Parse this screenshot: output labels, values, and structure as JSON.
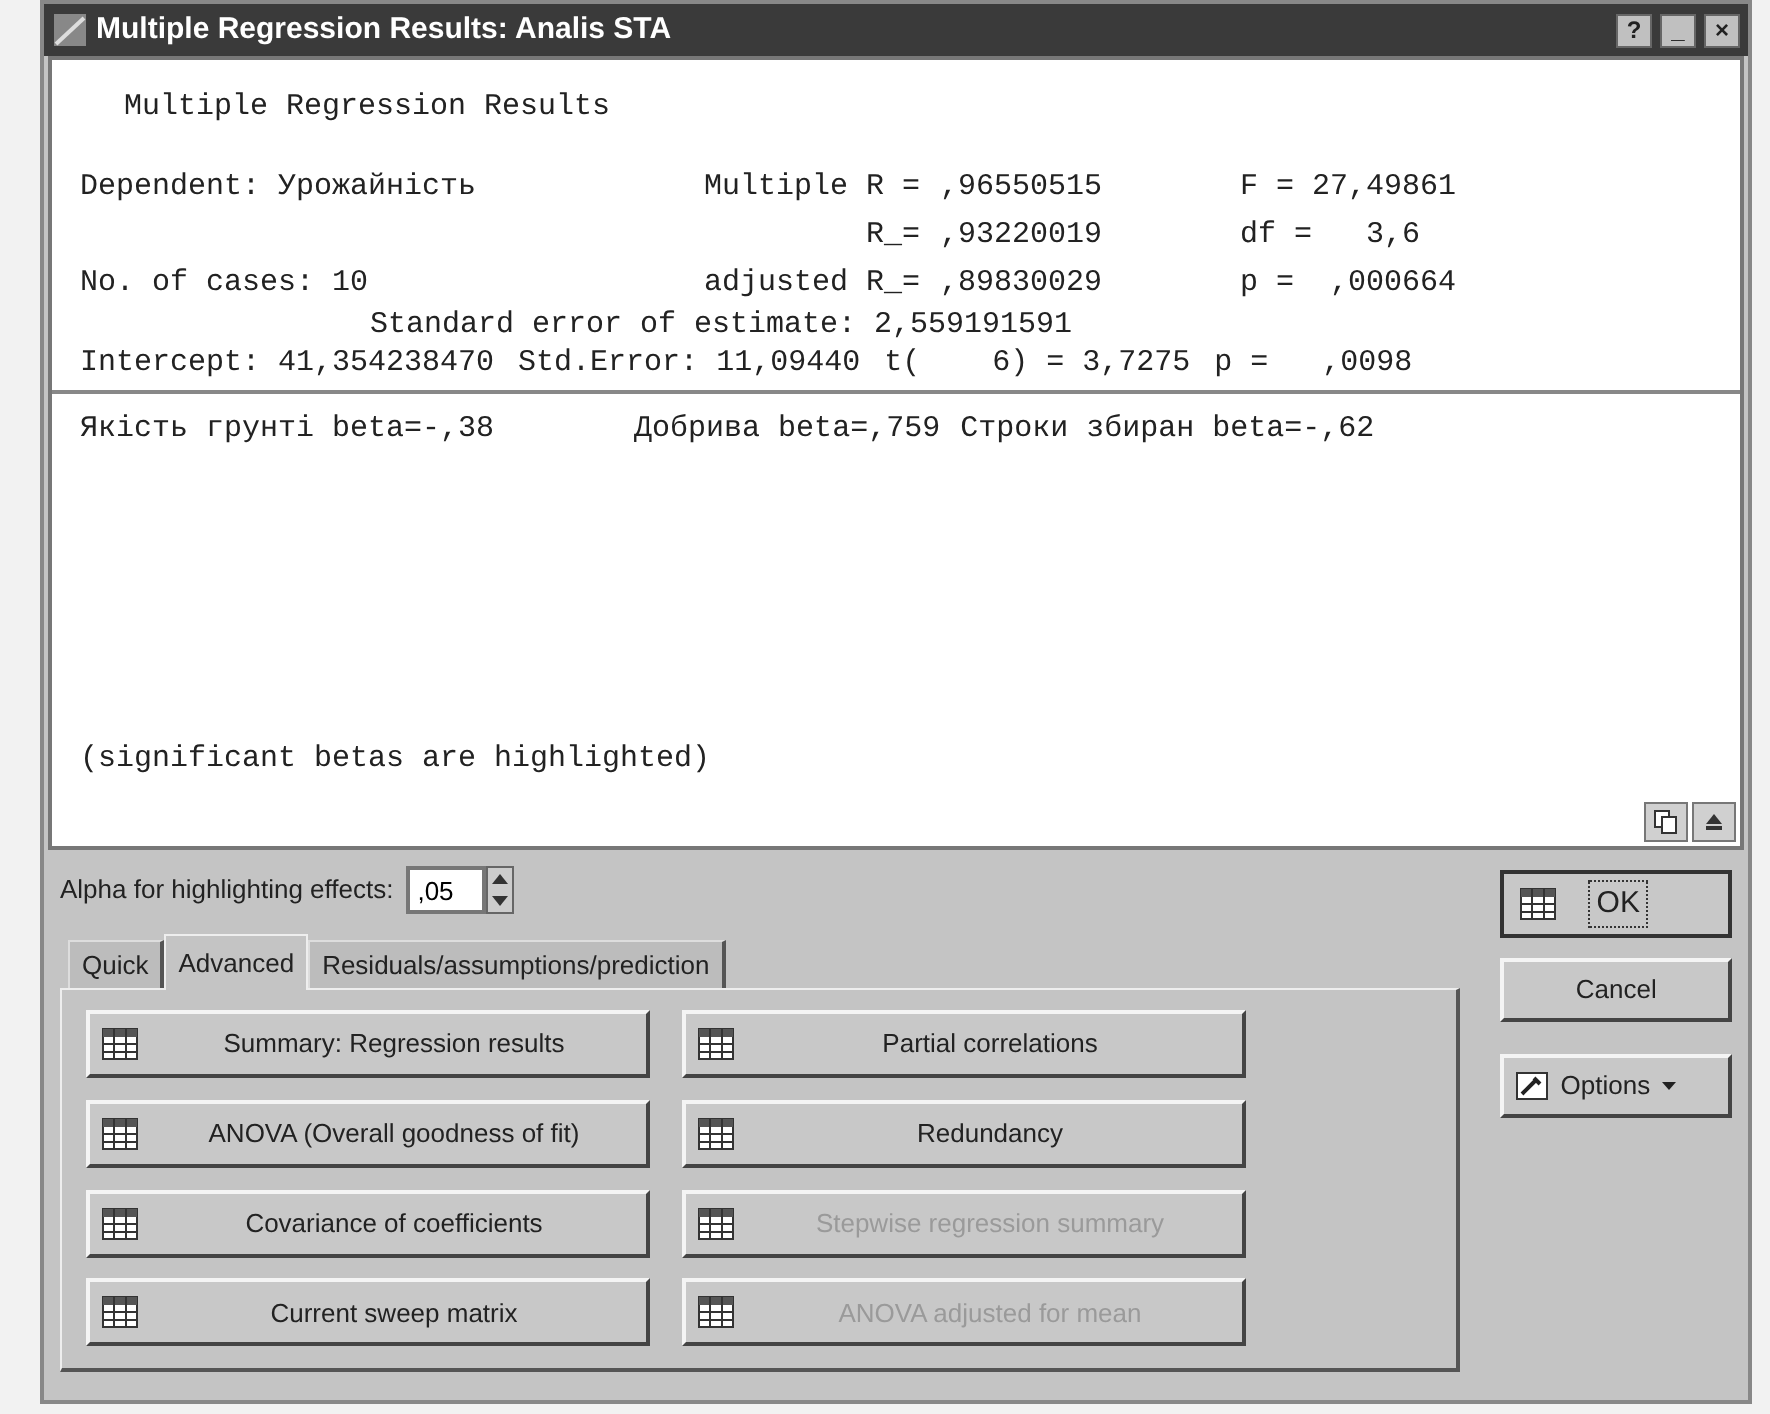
{
  "window": {
    "title": "Multiple Regression Results: Analis STA",
    "controls": [
      "?",
      "_",
      "×"
    ]
  },
  "output": {
    "heading": "Multiple Regression Results",
    "stats_rows": [
      {
        "left": "Dependent: Урожайність",
        "label": "Multiple R =",
        "value": ",96550515",
        "right": "F = 27,49861"
      },
      {
        "label": "R_=",
        "value": ",93220019",
        "right": "df =   3,6"
      },
      {
        "left": "No. of cases: 10",
        "label": "adjusted R_=",
        "value": ",89830029",
        "right": "p =  ,000664"
      }
    ],
    "std_error": "Standard error of estimate: 2,559191591",
    "intercept": [
      "Intercept: 41,354238470",
      "Std.Error: 11,09440",
      "t(    6) = 3,7275",
      "p =   ,0098"
    ],
    "betas": [
      "Якість грунті beta=-,38",
      "Добрива beta=,759",
      "Строки збиран beta=-,62"
    ],
    "note": "(significant betas are highlighted)"
  },
  "alpha": {
    "label": "Alpha for highlighting effects:",
    "value": ",05"
  },
  "tabs": [
    {
      "label": "Quick",
      "selected": false
    },
    {
      "label": "Advanced",
      "selected": true
    },
    {
      "label": "Residuals/assumptions/prediction",
      "selected": false
    }
  ],
  "buttons": [
    {
      "label": "Summary:  Regression results",
      "disabled": false
    },
    {
      "label": "Partial correlations",
      "disabled": false
    },
    {
      "label": "ANOVA (Overall goodness of fit)",
      "disabled": false
    },
    {
      "label": "Redundancy",
      "disabled": false
    },
    {
      "label": "Covariance of coefficients",
      "disabled": false
    },
    {
      "label": "Stepwise regression summary",
      "disabled": true
    },
    {
      "label": "Current sweep matrix",
      "disabled": false
    },
    {
      "label": "ANOVA adjusted for mean",
      "disabled": true
    }
  ],
  "side_buttons": [
    {
      "kind": "ok",
      "label": "OK"
    },
    {
      "kind": "cancel",
      "label": "Cancel"
    },
    {
      "kind": "options",
      "label": "Options"
    }
  ]
}
